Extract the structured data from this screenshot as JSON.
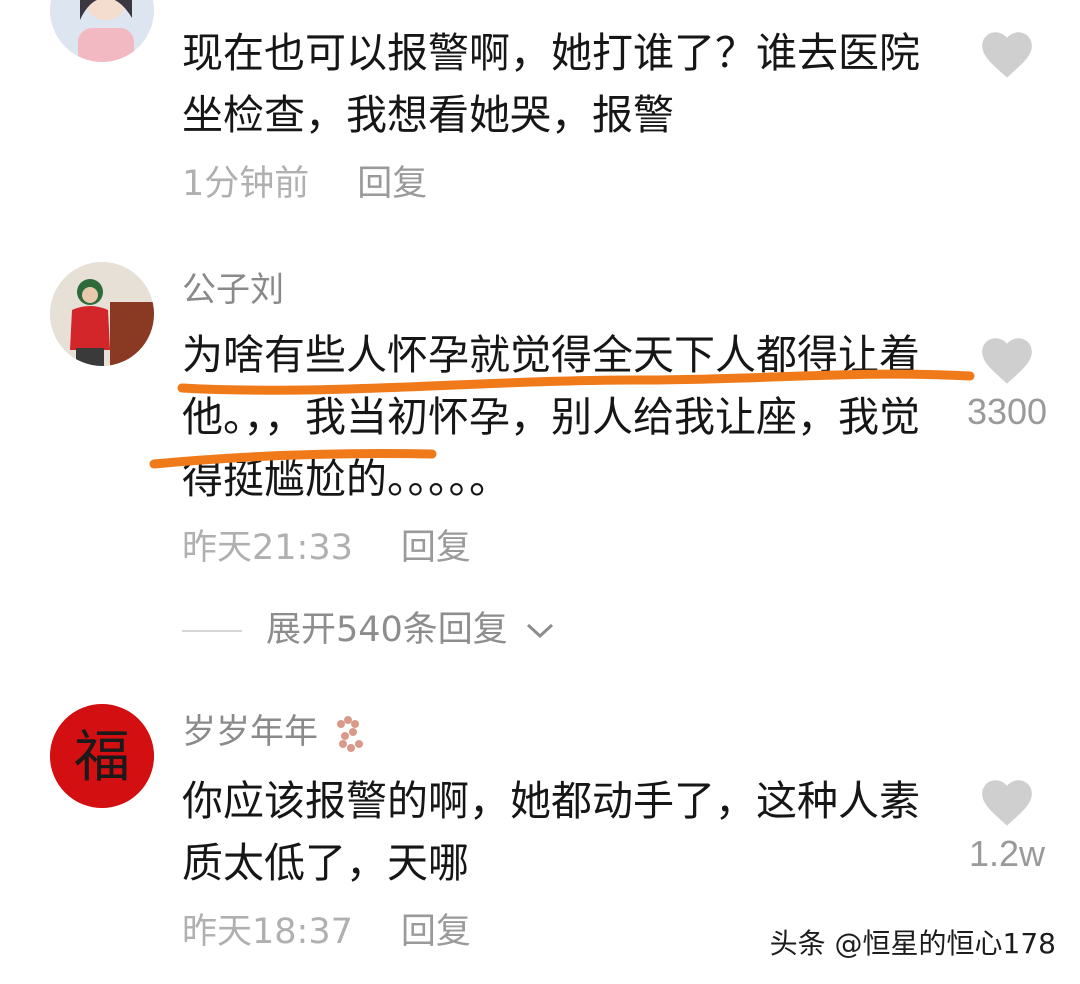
{
  "comments": [
    {
      "username": "",
      "text": "现在也可以报警啊，她打谁了？谁去医院坐检查，我想看她哭，报警",
      "time": "1分钟前",
      "reply": "回复",
      "likes": ""
    },
    {
      "username": "公子刘",
      "text": "为啥有些人怀孕就觉得全天下人都得让着他。，，我当初怀孕，别人给我让座，我觉得挺尴尬的。。。。。",
      "time": "昨天21:33",
      "reply": "回复",
      "likes": "3300",
      "expand": "展开540条回复"
    },
    {
      "username": "岁岁年年",
      "avatar_char": "福",
      "text": "你应该报警的啊，她都动手了，这种人素质太低了，天哪",
      "time": "昨天18:37",
      "reply": "回复",
      "likes": "1.2w"
    }
  ],
  "watermark": "头条 @恒星的恒心178",
  "icons": [
    "heart-icon",
    "chevron-down-icon"
  ],
  "colors": {
    "underline": "#f07a1a",
    "heart": "#cfcfcf",
    "avatar_red": "#d40f12"
  }
}
